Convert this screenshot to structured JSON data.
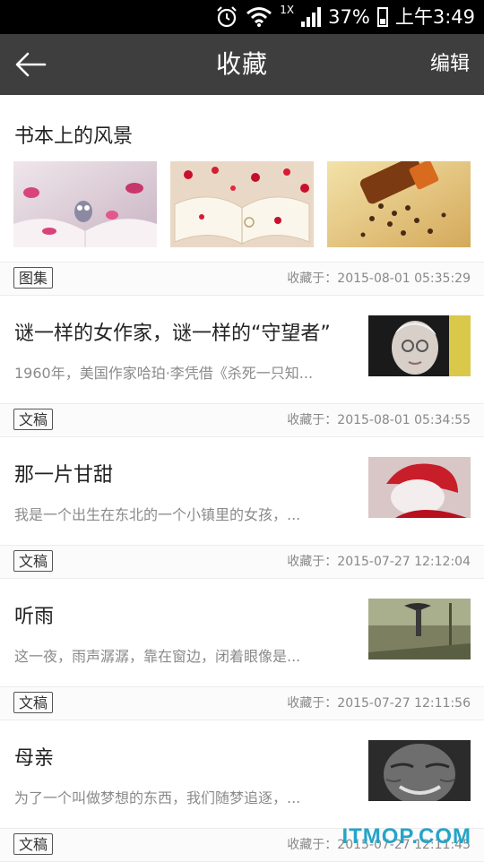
{
  "status": {
    "speed": "1X",
    "battery": "37%",
    "time": "上午3:49"
  },
  "header": {
    "title": "收藏",
    "edit_label": "编辑"
  },
  "gallery": {
    "title": "书本上的风景",
    "tag": "图集",
    "saved": "收藏于：2015-08-01 05:35:29"
  },
  "articles": [
    {
      "title": "谜一样的女作家，谜一样的“守望者”",
      "summary": "1960年，美国作家哈珀·李凭借《杀死一只知...",
      "tag": "文稿",
      "saved": "收藏于：2015-08-01 05:34:55"
    },
    {
      "title": "那一片甘甜",
      "summary": "我是一个出生在东北的一个小镇里的女孩，...",
      "tag": "文稿",
      "saved": "收藏于：2015-07-27 12:12:04"
    },
    {
      "title": "听雨",
      "summary": "这一夜，雨声潺潺，靠在窗边，闭着眼像是...",
      "tag": "文稿",
      "saved": "收藏于：2015-07-27 12:11:56"
    },
    {
      "title": "母亲",
      "summary": "为了一个叫做梦想的东西，我们随梦追逐，...",
      "tag": "文稿",
      "saved": "收藏于：2015-07-27 12:11:45"
    }
  ],
  "watermark": "ITMOP.COM"
}
